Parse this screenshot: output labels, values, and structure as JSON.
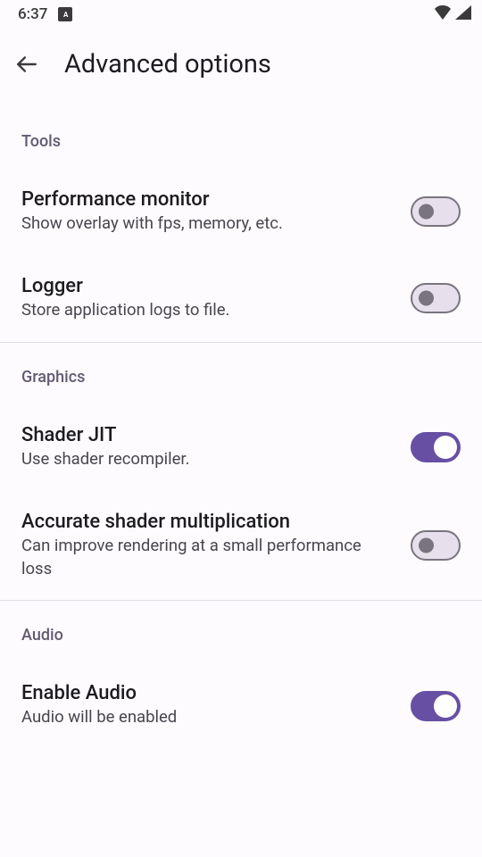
{
  "status": {
    "time": "6:37",
    "app_indicator": "A"
  },
  "header": {
    "title": "Advanced options"
  },
  "sections": {
    "tools": {
      "label": "Tools",
      "perf": {
        "title": "Performance monitor",
        "subtitle": "Show overlay with fps, memory, etc.",
        "enabled": false
      },
      "logger": {
        "title": "Logger",
        "subtitle": "Store application logs to file.",
        "enabled": false
      }
    },
    "graphics": {
      "label": "Graphics",
      "shader_jit": {
        "title": "Shader JIT",
        "subtitle": "Use shader recompiler.",
        "enabled": true
      },
      "accurate_mul": {
        "title": "Accurate shader multiplication",
        "subtitle": "Can improve rendering at a small performance loss",
        "enabled": false
      }
    },
    "audio": {
      "label": "Audio",
      "enable": {
        "title": "Enable Audio",
        "subtitle": "Audio will be enabled",
        "enabled": true
      }
    }
  }
}
